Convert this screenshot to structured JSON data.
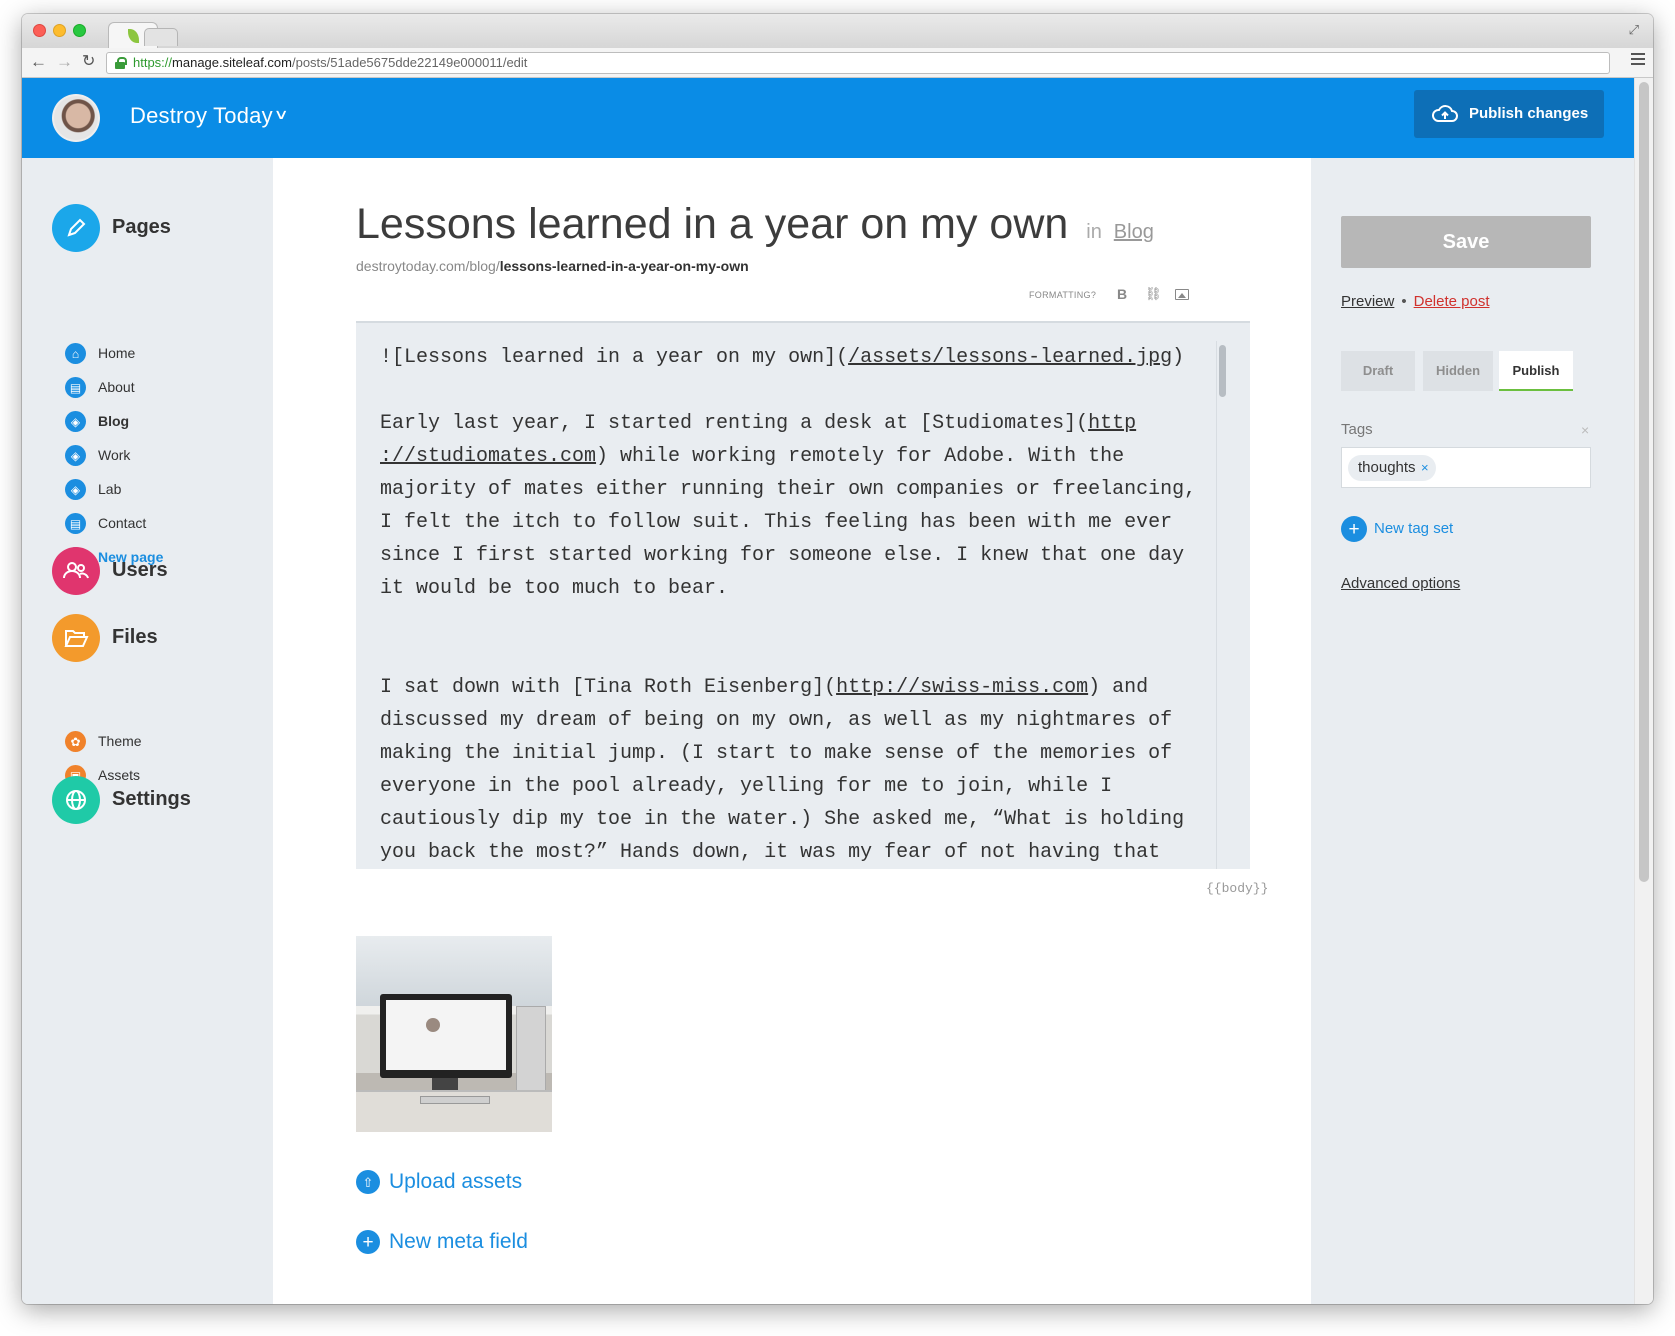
{
  "browser": {
    "url_scheme": "https://",
    "url_host": "manage.siteleaf.com",
    "url_path": "/posts/51ade5675dde22149e000011/edit"
  },
  "header": {
    "site_name": "Destroy Today",
    "publish_label": "Publish changes",
    "brand_color": "#0a8ce6"
  },
  "sidebar": {
    "pages_title": "Pages",
    "pages": [
      {
        "label": "Home"
      },
      {
        "label": "About"
      },
      {
        "label": "Blog"
      },
      {
        "label": "Work"
      },
      {
        "label": "Lab"
      },
      {
        "label": "Contact"
      }
    ],
    "new_page_label": "New page",
    "users_title": "Users",
    "files_title": "Files",
    "files": [
      {
        "label": "Theme"
      },
      {
        "label": "Assets"
      }
    ],
    "settings_title": "Settings",
    "colors": {
      "pages": "#1ba7ea",
      "users": "#e0356e",
      "files": "#f39a2c",
      "settings": "#1fcaa7"
    }
  },
  "post": {
    "title": "Lessons learned in a year on my own",
    "in_label": "in",
    "section": "Blog",
    "url_base": "destroytoday.com/blog/",
    "slug": "lessons-learned-in-a-year-on-my-own",
    "formatting_label": "FORMATTING?",
    "bold_label": "B",
    "body_line1_a": "![Lessons learned in a year on my own](",
    "body_line1_link": "/assets/lessons-learned.jpg",
    "body_line1_b": ")",
    "body_p2_a": "Early last year, I started renting a desk at [Studiomates](",
    "body_p2_link": "http\n://studiomates.com",
    "body_p2_b": ") while working remotely for Adobe. With the majority of mates either running their own companies or freelancing, I felt the itch to follow suit. This feeling has been with me ever since I first started working for someone else. I knew that one day it would be too much to bear.",
    "body_p3_a": "I sat down with [Tina Roth Eisenberg](",
    "body_p3_link": "http://swiss-miss.com",
    "body_p3_b": ") and discussed my dream of being on my own, as well as my nightmares of making the initial jump. (I start to make sense of the memories of everyone in the pool already, yelling for me to join, while I cautiously dip my toe in the water.) She asked me, “What is holding you back the most?” Hands down, it was my fear of not having that",
    "body_hint": "{{body}}",
    "upload_label": "Upload assets",
    "new_meta_label": "New meta field"
  },
  "panel": {
    "save_label": "Save",
    "preview_label": "Preview",
    "separator": "•",
    "delete_label": "Delete post",
    "status_options": [
      "Draft",
      "Hidden",
      "Publish"
    ],
    "status_selected": "Publish",
    "tags_label": "Tags",
    "tags_clear": "×",
    "tags": [
      "thoughts"
    ],
    "tag_remove": "×",
    "new_tagset_label": "New tag set",
    "advanced_label": "Advanced options"
  }
}
